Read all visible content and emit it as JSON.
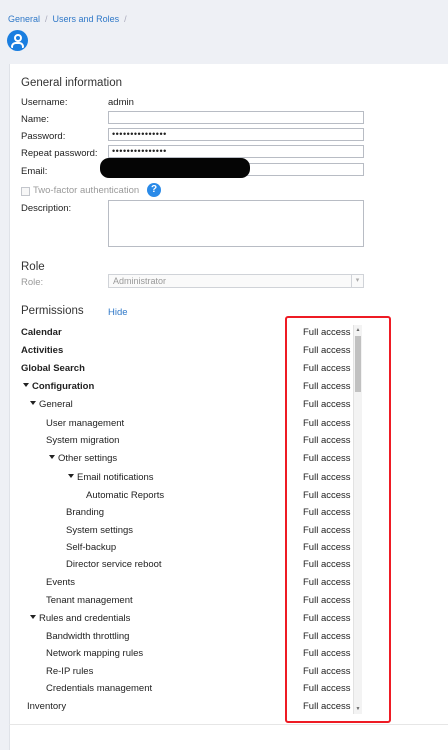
{
  "breadcrumb": {
    "items": [
      "General",
      "Users and Roles"
    ],
    "separator": "/"
  },
  "general": {
    "title": "General information",
    "username_label": "Username:",
    "username_value": "admin",
    "name_label": "Name:",
    "name_value": "",
    "password_label": "Password:",
    "password_value": "•••••••••••••••",
    "repeat_password_label": "Repeat password:",
    "repeat_password_value": "•••••••••••••••",
    "email_label": "Email:",
    "two_factor_label": "Two-factor authentication",
    "description_label": "Description:"
  },
  "role": {
    "title": "Role",
    "role_label": "Role:",
    "role_value": "Administrator"
  },
  "permissions": {
    "title": "Permissions",
    "hide_label": "Hide",
    "rows": [
      {
        "name": "Calendar",
        "access": "Full access"
      },
      {
        "name": "Activities",
        "access": "Full access"
      },
      {
        "name": "Global Search",
        "access": "Full access"
      },
      {
        "name": "Configuration",
        "access": "Full access"
      },
      {
        "name": "General",
        "access": "Full access"
      },
      {
        "name": "User management",
        "access": "Full access"
      },
      {
        "name": "System migration",
        "access": "Full access"
      },
      {
        "name": "Other settings",
        "access": "Full access"
      },
      {
        "name": "Email notifications",
        "access": "Full access"
      },
      {
        "name": "Automatic Reports",
        "access": "Full access"
      },
      {
        "name": "Branding",
        "access": "Full access"
      },
      {
        "name": "System settings",
        "access": "Full access"
      },
      {
        "name": "Self-backup",
        "access": "Full access"
      },
      {
        "name": "Director service reboot",
        "access": "Full access"
      },
      {
        "name": "Events",
        "access": "Full access"
      },
      {
        "name": "Tenant management",
        "access": "Full access"
      },
      {
        "name": "Rules and credentials",
        "access": "Full access"
      },
      {
        "name": "Bandwidth throttling",
        "access": "Full access"
      },
      {
        "name": "Network mapping rules",
        "access": "Full access"
      },
      {
        "name": "Re-IP rules",
        "access": "Full access"
      },
      {
        "name": "Credentials management",
        "access": "Full access"
      },
      {
        "name": "Inventory",
        "access": "Full access"
      }
    ]
  },
  "colors": {
    "accent": "#1a7ee0",
    "link": "#2f78c8",
    "highlight": "#ee1b24"
  }
}
